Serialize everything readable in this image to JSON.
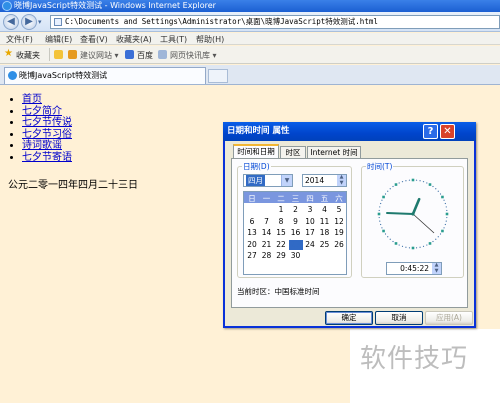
{
  "window": {
    "title": "晓博JavaScript特效测试 - Windows Internet Explorer",
    "url": "C:\\Documents and Settings\\Administrator\\桌面\\晓博JavaScript特效测试.html",
    "tab_label": "晓博JavaScript特效测试"
  },
  "menu": [
    "文件(F)",
    "编辑(E)",
    "查看(V)",
    "收藏夹(A)",
    "工具(T)",
    "帮助(H)"
  ],
  "favorites_bar": {
    "favorites": "收藏夹",
    "suggested_sites": "建议网站 ▾",
    "baidu": "百度",
    "web_slice": "网页快讯库 ▾"
  },
  "page": {
    "nav_links": [
      "首页",
      "七夕简介",
      "七夕节传说",
      "七夕节习俗",
      "诗词歌谣",
      "七夕节寄语"
    ],
    "date_text": "公元二零一四年四月二十三日"
  },
  "dialog": {
    "title": "日期和时间 属性",
    "tabs": [
      "时间和日期",
      "时区",
      "Internet 时间"
    ],
    "date_group_label": "日期(D)",
    "time_group_label": "时间(T)",
    "month": "四月",
    "year": "2014",
    "weekdays": [
      "日",
      "一",
      "二",
      "三",
      "四",
      "五",
      "六"
    ],
    "selected_day": 23,
    "time": "0:45:22",
    "clock": {
      "hour": 0,
      "minute": 45,
      "second": 22
    },
    "timezone_text": "当前时区：中国标准时间",
    "buttons": {
      "ok": "确定",
      "cancel": "取消",
      "apply": "应用(A)"
    }
  },
  "watermark": "软件技巧"
}
